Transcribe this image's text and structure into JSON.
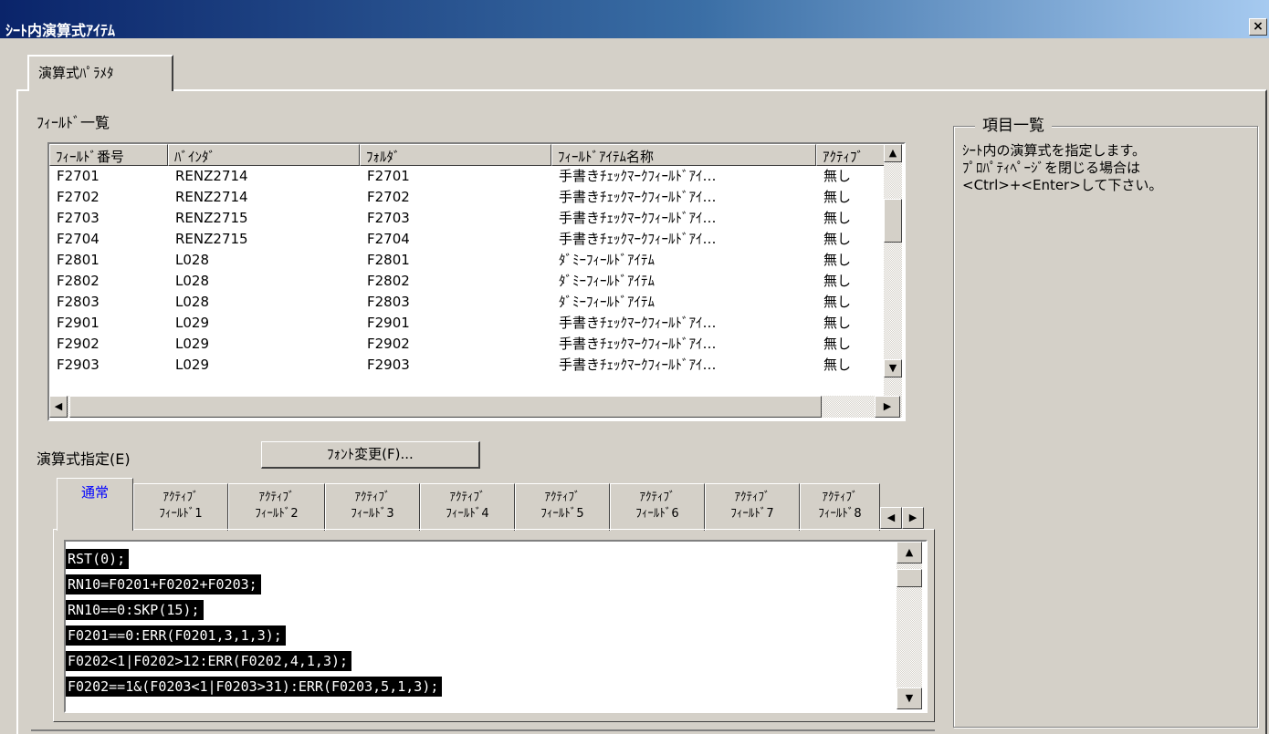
{
  "window": {
    "title": "ｼｰﾄ内演算式ｱｲﾃﾑ",
    "close_label": "×"
  },
  "outer_tab": {
    "label": "演算式ﾊﾟﾗﾒﾀ"
  },
  "field_list": {
    "label": "ﾌｨｰﾙﾄﾞ一覧",
    "columns": [
      "ﾌｨｰﾙﾄﾞ番号",
      "ﾊﾞｲﾝﾀﾞ",
      "ﾌｫﾙﾀﾞ",
      "ﾌｨｰﾙﾄﾞｱｲﾃﾑ名称",
      "ｱｸﾃｨﾌﾞ"
    ],
    "rows": [
      [
        "F2701",
        "RENZ2714",
        "F2701",
        "手書きﾁｪｯｸﾏｰｸﾌｨｰﾙﾄﾞｱｲ…",
        "無し"
      ],
      [
        "F2702",
        "RENZ2714",
        "F2702",
        "手書きﾁｪｯｸﾏｰｸﾌｨｰﾙﾄﾞｱｲ…",
        "無し"
      ],
      [
        "F2703",
        "RENZ2715",
        "F2703",
        "手書きﾁｪｯｸﾏｰｸﾌｨｰﾙﾄﾞｱｲ…",
        "無し"
      ],
      [
        "F2704",
        "RENZ2715",
        "F2704",
        "手書きﾁｪｯｸﾏｰｸﾌｨｰﾙﾄﾞｱｲ…",
        "無し"
      ],
      [
        "F2801",
        "L028",
        "F2801",
        "ﾀﾞﾐｰﾌｨｰﾙﾄﾞｱｲﾃﾑ",
        "無し"
      ],
      [
        "F2802",
        "L028",
        "F2802",
        "ﾀﾞﾐｰﾌｨｰﾙﾄﾞｱｲﾃﾑ",
        "無し"
      ],
      [
        "F2803",
        "L028",
        "F2803",
        "ﾀﾞﾐｰﾌｨｰﾙﾄﾞｱｲﾃﾑ",
        "無し"
      ],
      [
        "F2901",
        "L029",
        "F2901",
        "手書きﾁｪｯｸﾏｰｸﾌｨｰﾙﾄﾞｱｲ…",
        "無し"
      ],
      [
        "F2902",
        "L029",
        "F2902",
        "手書きﾁｪｯｸﾏｰｸﾌｨｰﾙﾄﾞｱｲ…",
        "無し"
      ],
      [
        "F2903",
        "L029",
        "F2903",
        "手書きﾁｪｯｸﾏｰｸﾌｨｰﾙﾄﾞｱｲ…",
        "無し"
      ]
    ]
  },
  "formula": {
    "label": "演算式指定(E)",
    "font_button": "ﾌｫﾝﾄ変更(F)...",
    "tabs": [
      {
        "line1": "通常",
        "line2": ""
      },
      {
        "line1": "ｱｸﾃｨﾌﾞ",
        "line2": "ﾌｨｰﾙﾄﾞ1"
      },
      {
        "line1": "ｱｸﾃｨﾌﾞ",
        "line2": "ﾌｨｰﾙﾄﾞ2"
      },
      {
        "line1": "ｱｸﾃｨﾌﾞ",
        "line2": "ﾌｨｰﾙﾄﾞ3"
      },
      {
        "line1": "ｱｸﾃｨﾌﾞ",
        "line2": "ﾌｨｰﾙﾄﾞ4"
      },
      {
        "line1": "ｱｸﾃｨﾌﾞ",
        "line2": "ﾌｨｰﾙﾄﾞ5"
      },
      {
        "line1": "ｱｸﾃｨﾌﾞ",
        "line2": "ﾌｨｰﾙﾄﾞ6"
      },
      {
        "line1": "ｱｸﾃｨﾌﾞ",
        "line2": "ﾌｨｰﾙﾄﾞ7"
      },
      {
        "line1": "ｱｸﾃｨﾌﾞ",
        "line2": "ﾌｨｰﾙﾄﾞ8"
      }
    ],
    "active_tab_color": "#0000ff",
    "code_lines": [
      "RST(0);",
      "RN10=F0201+F0202+F0203;",
      "RN10==0:SKP(15);",
      "F0201==0:ERR(F0201,3,1,3);",
      "F0202<1|F0202>12:ERR(F0202,4,1,3);",
      "F0202==1&(F0203<1|F0203>31):ERR(F0203,5,1,3);"
    ]
  },
  "item_list": {
    "title": "項目一覧",
    "description_lines": [
      "ｼｰﾄ内の演算式を指定します。",
      "ﾌﾟﾛﾊﾟﾃｨﾍﾟｰｼﾞを閉じる場合は",
      "<Ctrl>+<Enter>して下さい。"
    ]
  },
  "icons": {
    "scroll_up": "triangle-up-icon",
    "scroll_down": "triangle-down-icon",
    "scroll_left": "triangle-left-icon",
    "scroll_right": "triangle-right-icon"
  }
}
